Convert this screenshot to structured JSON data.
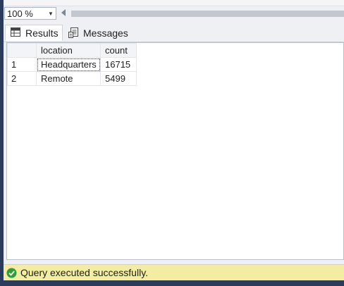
{
  "toolbar": {
    "zoom_value": "100 %",
    "zoom_arrow": "▼"
  },
  "tabs": [
    {
      "label": "Results",
      "icon": "grid-icon",
      "active": true
    },
    {
      "label": "Messages",
      "icon": "messages-icon",
      "active": false
    }
  ],
  "results": {
    "columns": [
      "",
      "location",
      "count"
    ],
    "rows": [
      {
        "num": "1",
        "location": "Headquarters",
        "count": "16715"
      },
      {
        "num": "2",
        "location": "Remote",
        "count": "5499"
      }
    ]
  },
  "status": {
    "text": "Query executed successfully.",
    "icon": "check-circle-icon",
    "color": "#2e9d3a"
  }
}
